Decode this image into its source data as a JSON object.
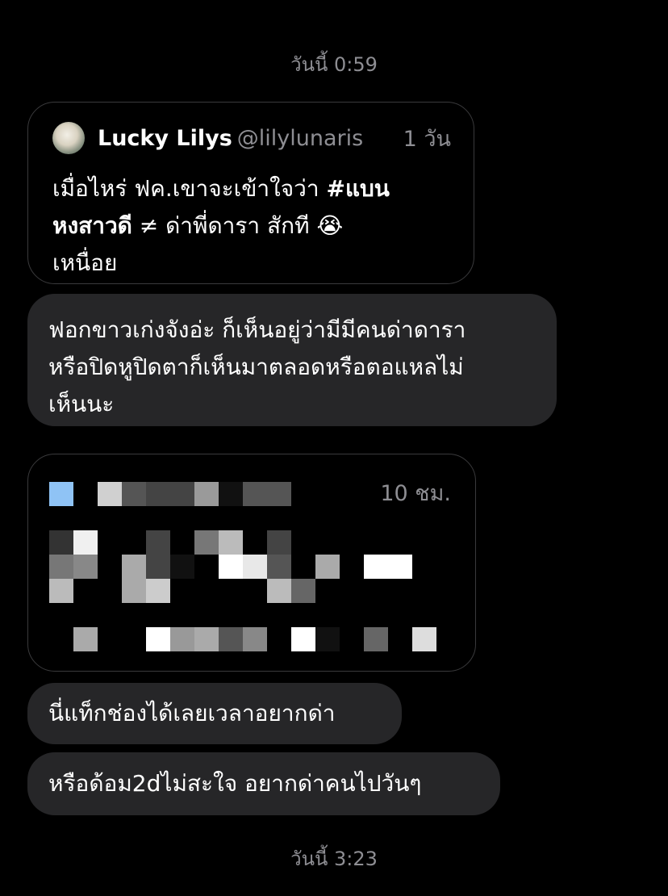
{
  "timestamps": {
    "first": "วันนี้ 0:59",
    "second": "วันนี้ 3:23"
  },
  "quoted_post": {
    "author_name": "Lucky Lilys",
    "author_handle": "@lilylunaris",
    "time": "1 วัน",
    "text_line1": "เมื่อไหร่ ฟค.เขาจะเข้าใจว่า ",
    "hashtag_part1": "#แบน",
    "hashtag_part2": "หงสาวดี",
    "text_line2_rest": " ≠ ด่าพี่ดารา สักที 😭",
    "text_line3": "เหนื่อย"
  },
  "messages": [
    {
      "line1": "ฟอกขาวเก่งจังอ่ะ ก็เห็นอยู่ว่ามีมีคนด่าดารา",
      "line2": "หรือปิดหูปิดตาก็เห็นมาตลอดหรือตอแหลไม่",
      "line3": "เห็นนะ"
    },
    {
      "text": "นี่แท็กช่องได้เลยเวลาอยากด่า"
    },
    {
      "text": "หรือด้อม2dไม่สะใจ อยากด่าคนไปวันๆ"
    }
  ],
  "censored_post": {
    "time": "10 ชม."
  },
  "colors": {
    "background": "#000000",
    "bubble": "#262628",
    "secondary_text": "#8e8e93",
    "card_border": "#3a3a3c"
  }
}
